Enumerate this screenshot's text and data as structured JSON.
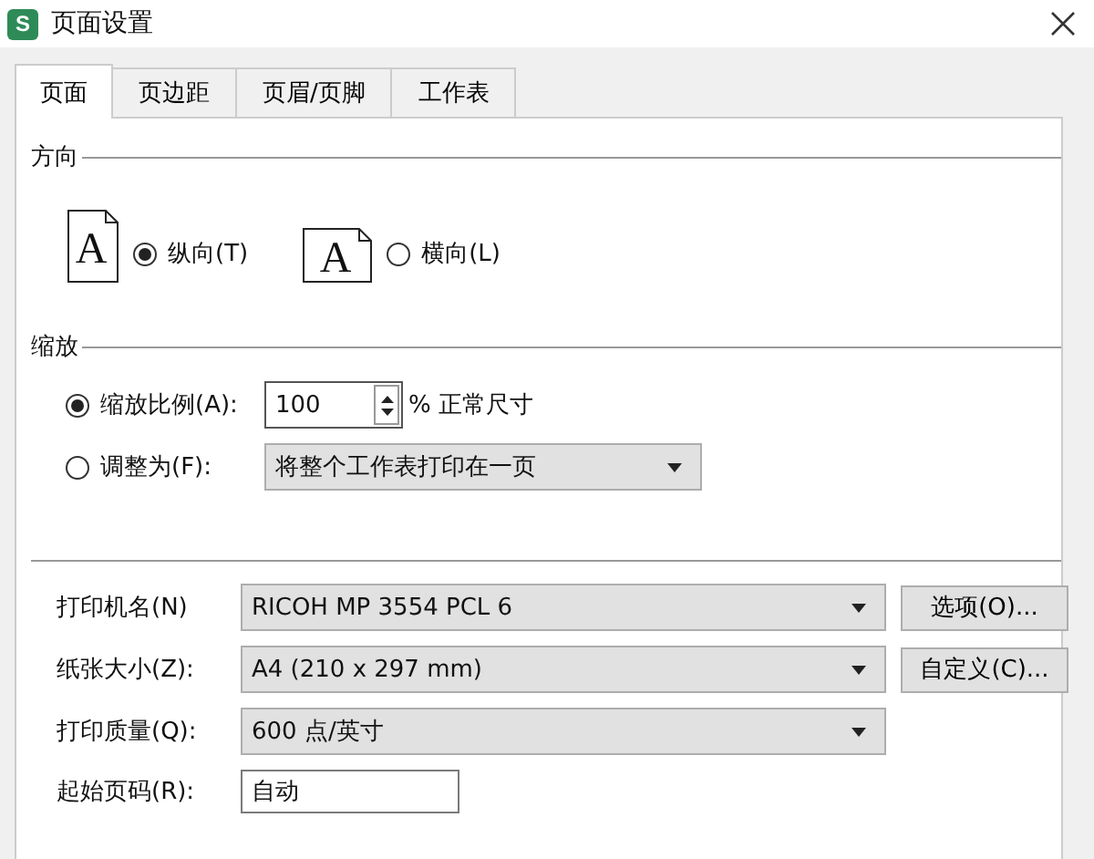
{
  "window": {
    "title": "页面设置",
    "app_icon": "S"
  },
  "tabs": [
    {
      "label": "页面",
      "selected": true
    },
    {
      "label": "页边距",
      "selected": false
    },
    {
      "label": "页眉/页脚",
      "selected": false
    },
    {
      "label": "工作表",
      "selected": false
    }
  ],
  "orientation": {
    "heading": "方向",
    "options": [
      {
        "kind": "portrait",
        "glyph": "A",
        "label": "纵向(T)",
        "selected": true
      },
      {
        "kind": "landscape",
        "glyph": "A",
        "label": "横向(L)",
        "selected": false
      }
    ]
  },
  "scaling": {
    "heading": "缩放",
    "options": [
      {
        "kind": "spin",
        "label": "缩放比例(A):",
        "selected": true,
        "value": "100",
        "suffix": "% 正常尺寸"
      },
      {
        "kind": "dropdown",
        "label": "调整为(F):",
        "selected": false,
        "value": "将整个工作表打印在一页"
      }
    ]
  },
  "print": [
    {
      "kind": "dropdown",
      "label": "打印机名(N)",
      "value": "RICOH MP 3554 PCL 6",
      "button": "选项(O)..."
    },
    {
      "kind": "dropdown",
      "label": "纸张大小(Z):",
      "value": "A4 (210 x 297 mm)",
      "button": "自定义(C)..."
    },
    {
      "kind": "dropdown",
      "label": "打印质量(Q):",
      "value": "600 点/英寸"
    },
    {
      "kind": "input",
      "label": "起始页码(R):",
      "value": "自动"
    }
  ]
}
